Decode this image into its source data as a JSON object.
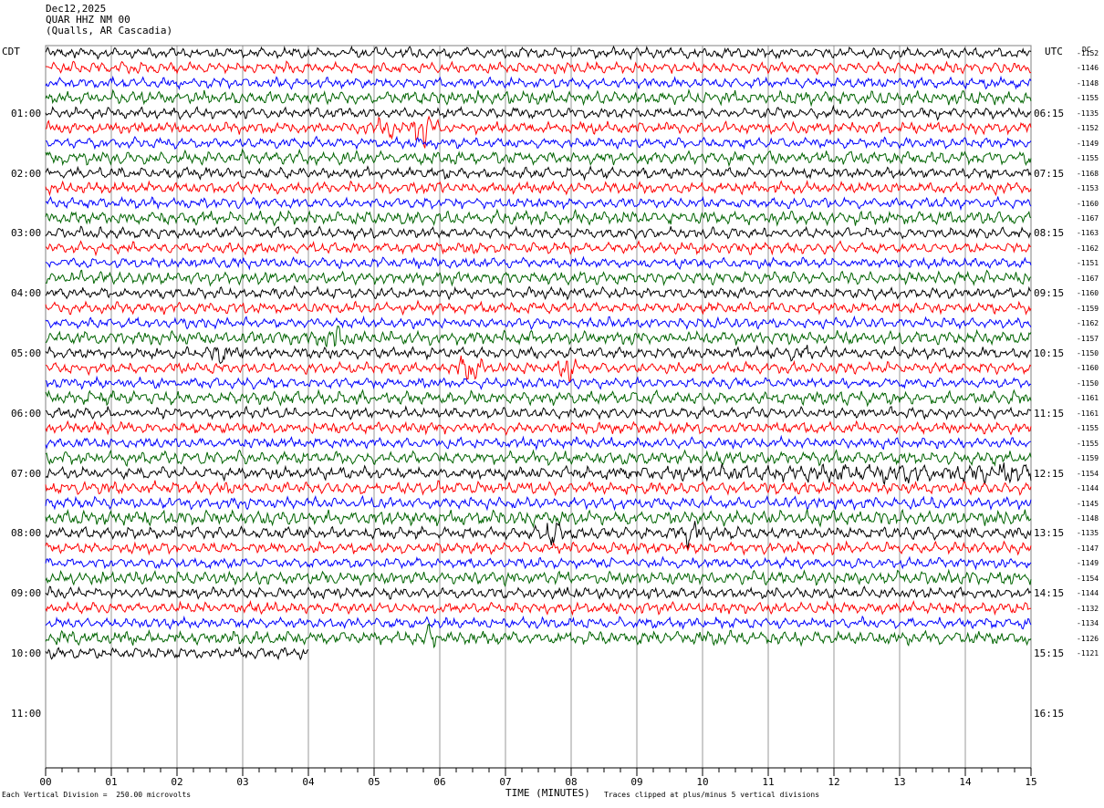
{
  "header": {
    "date": "Dec12,2025",
    "station": "QUAR HHZ NM 00",
    "location": "(Qualls, AR Cascadia)"
  },
  "left_zone_label": "CDT",
  "right_zone_label": "UTC",
  "dc_label": "DC",
  "footer": {
    "scale_note": "Each Vertical Division =  250.00 microvolts",
    "clip_note": "Traces clipped at plus/minus 5 vertical divisions",
    "x_title": "TIME (MINUTES)"
  },
  "colors": {
    "black": "#000000",
    "red": "#ff0000",
    "blue": "#0000ff",
    "green": "#006400",
    "grid": "#808080"
  },
  "chart_data": {
    "type": "line",
    "x_title": "TIME (MINUTES)",
    "x_ticks": [
      "00",
      "01",
      "02",
      "03",
      "04",
      "05",
      "06",
      "07",
      "08",
      "09",
      "10",
      "11",
      "12",
      "13",
      "14",
      "15"
    ],
    "xlim": [
      0,
      15
    ],
    "left_hour_labels": [
      "01:00",
      "02:00",
      "03:00",
      "04:00",
      "05:00",
      "06:00",
      "07:00",
      "08:00",
      "09:00",
      "10:00",
      "11:00"
    ],
    "right_hour_labels": [
      "06:15",
      "07:15",
      "08:15",
      "09:15",
      "10:15",
      "11:15",
      "12:15",
      "13:15",
      "14:15",
      "15:15",
      "16:15"
    ],
    "trace_count": 41,
    "trace_colors": [
      "black",
      "red",
      "blue",
      "green"
    ],
    "last_trace_end_minute": 4.0,
    "dc_offsets": [
      -1152,
      -1146,
      -1148,
      -1155,
      -1135,
      -1152,
      -1149,
      -1155,
      -1168,
      -1153,
      -1160,
      -1167,
      -1163,
      -1162,
      -1151,
      -1167,
      -1160,
      -1159,
      -1162,
      -1157,
      -1150,
      -1160,
      -1150,
      -1161,
      -1161,
      -1155,
      -1155,
      -1159,
      -1154,
      -1144,
      -1145,
      -1148,
      -1135,
      -1147,
      -1149,
      -1154,
      -1144,
      -1132,
      -1134,
      -1126,
      -1121
    ],
    "events": [
      {
        "trace": 5,
        "minute": 5.2,
        "amp": 2.2
      },
      {
        "trace": 5,
        "minute": 5.75,
        "amp": 3.0
      },
      {
        "trace": 21,
        "minute": 6.45,
        "amp": 3.0
      },
      {
        "trace": 21,
        "minute": 7.95,
        "amp": 1.6
      },
      {
        "trace": 20,
        "minute": 2.7,
        "amp": 1.5
      },
      {
        "trace": 20,
        "minute": 11.45,
        "amp": 1.3
      },
      {
        "trace": 19,
        "minute": 4.4,
        "amp": 1.4
      },
      {
        "trace": 32,
        "minute": 7.7,
        "amp": 2.4
      },
      {
        "trace": 32,
        "minute": 9.8,
        "amp": 1.7
      },
      {
        "trace": 39,
        "minute": 5.8,
        "amp": 1.3
      }
    ]
  }
}
